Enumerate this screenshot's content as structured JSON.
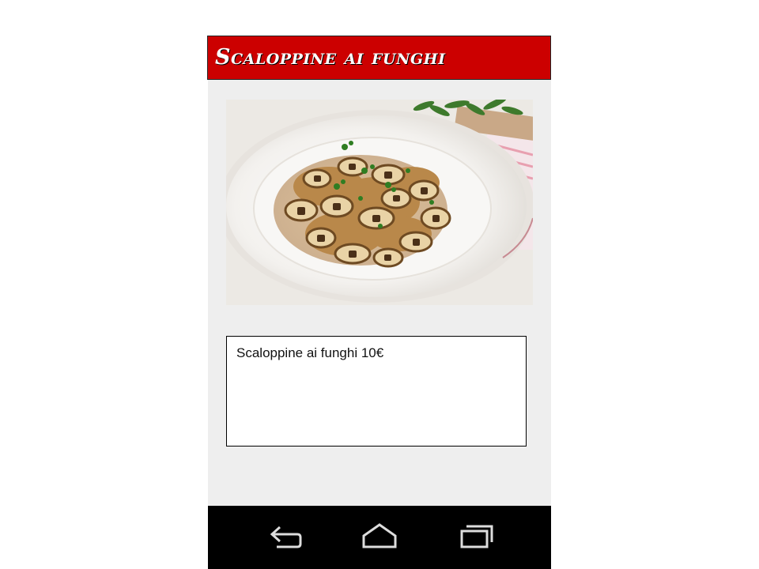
{
  "header": {
    "title": "Scaloppine ai funghi"
  },
  "dish": {
    "image_alt": "Scaloppine ai funghi",
    "description": "Scaloppine ai funghi 10€"
  },
  "nav": {
    "buttons": [
      {
        "name": "back-button",
        "icon": "back-arrow-icon"
      },
      {
        "name": "home-button",
        "icon": "home-icon"
      },
      {
        "name": "recent-apps-button",
        "icon": "recent-apps-icon"
      }
    ]
  },
  "colors": {
    "title_bar": "#cc0000",
    "background": "#eeeeee",
    "nav_bar": "#000000"
  }
}
